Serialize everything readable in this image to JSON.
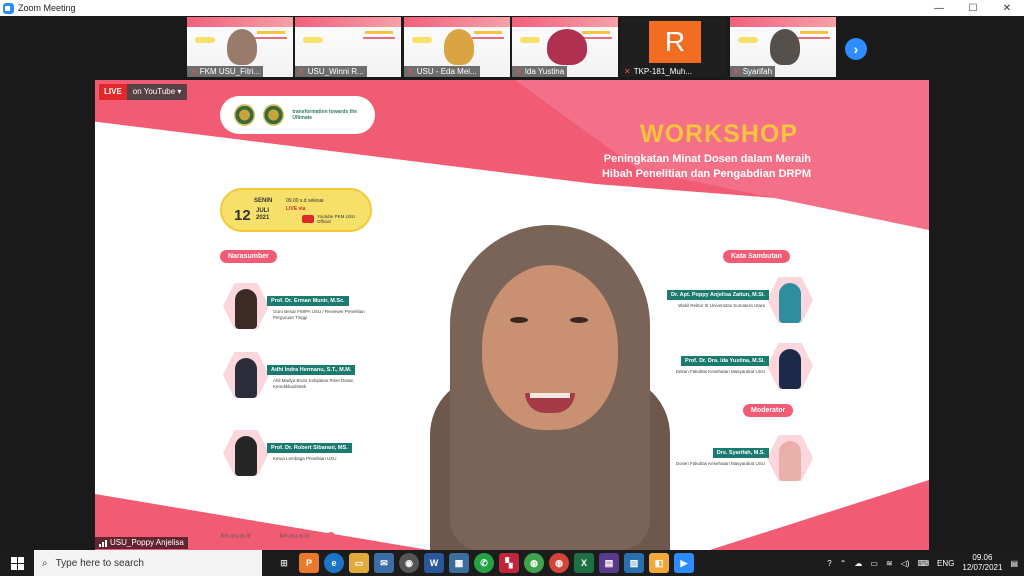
{
  "window": {
    "title": "Zoom Meeting",
    "minimize": "—",
    "maximize": "☐",
    "close": "✕"
  },
  "participants": [
    {
      "name": "FKM USU_Fitri..."
    },
    {
      "name": "USU_Winni R..."
    },
    {
      "name": "USU - Eda Mei..."
    },
    {
      "name": "Ida Yustina"
    },
    {
      "name": "TKP-181_Muh...",
      "initial": "R"
    },
    {
      "name": "Syarifah"
    }
  ],
  "next_button": "›",
  "stream": {
    "live": "LIVE",
    "platform": "on YouTube ▾"
  },
  "slide": {
    "logo_text": "transformation towards the Ultimate",
    "title": "WORKSHOP",
    "subtitle_1": "Peningkatan Minat Dosen dalam Meraih",
    "subtitle_2": "Hibah Penelitian dan Pengabdian DRPM",
    "date": {
      "day": "SENIN",
      "num": "12",
      "month": "JULI",
      "year": "2021",
      "time": "09.00 s.d selesai",
      "live_via": "LIVE via",
      "yt_label": "Youtube PKM USU Official"
    },
    "narasumber_label": "Narasumber",
    "kata_sambutan_label": "Kata Sambutan",
    "moderator_label": "Moderator",
    "speakers_left": [
      {
        "name": "Prof. Dr. Erman Munir, M.Sc.",
        "role": "Guru Besar FMIPA USU / Reviewer Penelitian Perguruan Tinggi"
      },
      {
        "name": "Adhi Indra Hermanu, S.T., M.M.",
        "role": "Ahli Madya Bruto Kebijakan Riset Dasar, Kemdikbudristek"
      },
      {
        "name": "Prof. Dr. Robert Sibarani, MS.",
        "role": "Ketua Lembaga Penelitian USU"
      }
    ],
    "speakers_right": [
      {
        "name": "Dr. Apt. Poppy Anjelisa Zaitun, M.Si.",
        "role": "Wakil Rektor III Universitas Sumatera Utara"
      },
      {
        "name": "Prof. Dr. Dra. Ida Yustina, M.Si.",
        "role": "Dekan Fakultas Kesehatan Masyarakat USU"
      },
      {
        "name": "Drs. Syarifah, M.S.",
        "role": "Dosen Fakultas Kesehatan Masyarakat USU"
      }
    ],
    "footer": [
      "fkm.usu.ac.id",
      "fkm.usu.ac.id",
      ""
    ]
  },
  "active_speaker": "USU_Poppy Anjelisa",
  "taskbar": {
    "search_placeholder": "Type here to search",
    "lang": "ENG",
    "time": "09.06",
    "date": "12/07/2021"
  }
}
